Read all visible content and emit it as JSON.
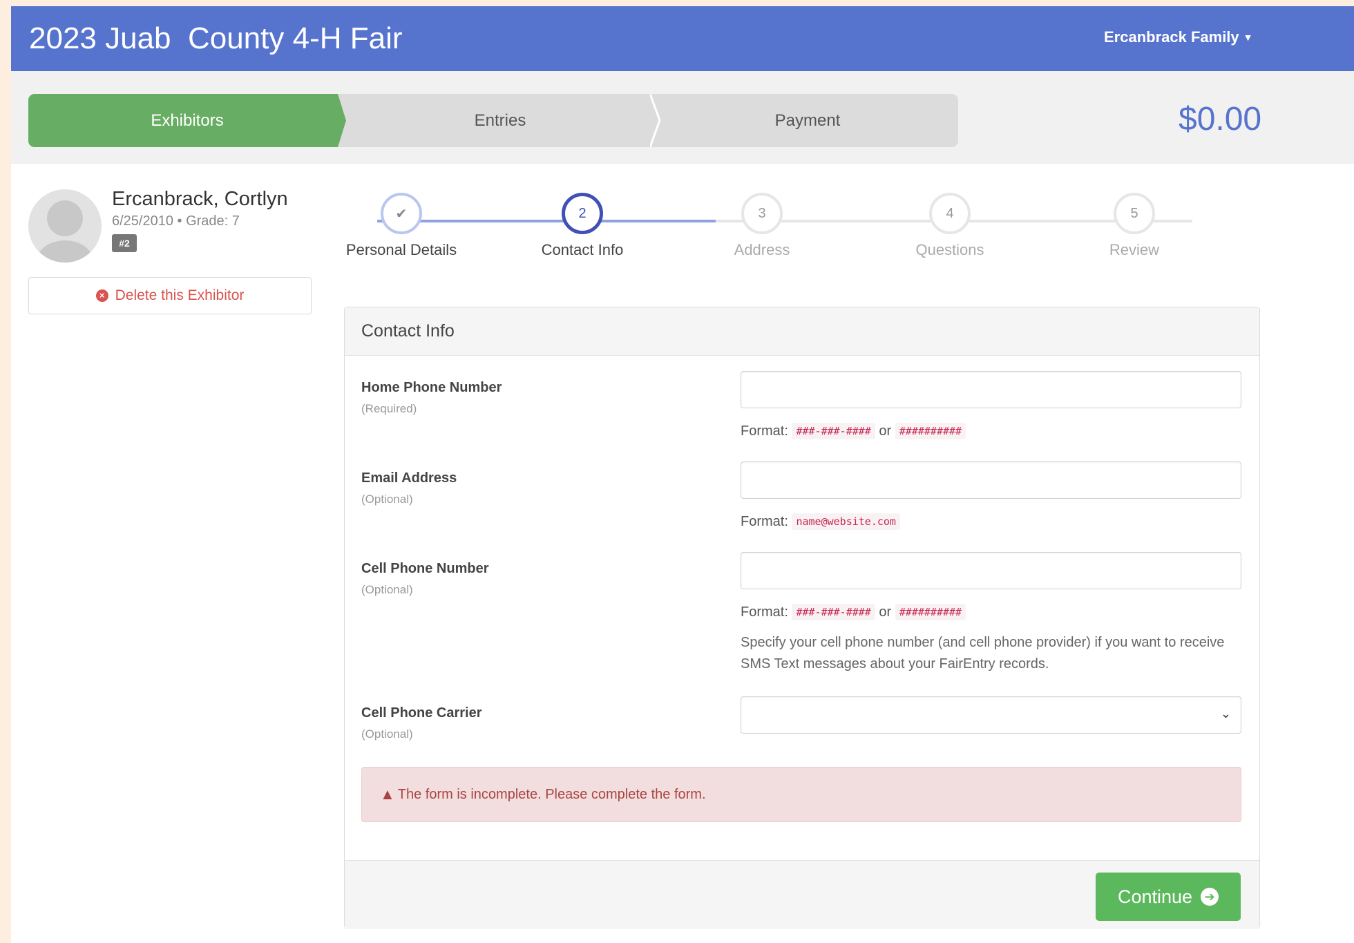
{
  "header": {
    "title": "2023 Juab  County 4-H Fair",
    "user_menu": "Ercanbrack Family"
  },
  "progress": {
    "steps": [
      "Exhibitors",
      "Entries",
      "Payment"
    ],
    "active": "Exhibitors",
    "total": "$0.00"
  },
  "exhibitor": {
    "name": "Ercanbrack, Cortlyn",
    "meta": "6/25/2010 • Grade: 7",
    "badge": "#2",
    "delete_label": "Delete this Exhibitor"
  },
  "wizard": {
    "steps": [
      {
        "number": "",
        "label": "Personal Details",
        "state": "done"
      },
      {
        "number": "2",
        "label": "Contact Info",
        "state": "active"
      },
      {
        "number": "3",
        "label": "Address",
        "state": "pending"
      },
      {
        "number": "4",
        "label": "Questions",
        "state": "pending"
      },
      {
        "number": "5",
        "label": "Review",
        "state": "pending"
      }
    ]
  },
  "form": {
    "heading": "Contact Info",
    "home_phone": {
      "label": "Home Phone Number",
      "sub": "(Required)",
      "value": "",
      "format_prefix": "Format:",
      "format_a": "###-###-####",
      "format_or": "or",
      "format_b": "##########"
    },
    "email": {
      "label": "Email Address",
      "sub": "(Optional)",
      "value": "",
      "format_prefix": "Format:",
      "format_a": "name@website.com"
    },
    "cell_phone": {
      "label": "Cell Phone Number",
      "sub": "(Optional)",
      "value": "",
      "format_prefix": "Format:",
      "format_a": "###-###-####",
      "format_or": "or",
      "format_b": "##########",
      "help": "Specify your cell phone number (and cell phone provider) if you want to receive SMS Text messages about your FairEntry records."
    },
    "carrier": {
      "label": "Cell Phone Carrier",
      "sub": "(Optional)",
      "selected": ""
    },
    "alert": "The form is incomplete. Please complete the form.",
    "continue_label": "Continue"
  },
  "colors": {
    "header": "#5673ce",
    "active_step": "#68ad64",
    "danger": "#d9534f",
    "success": "#5cb85c",
    "wizard_active": "#3f51b5"
  },
  "icons": {
    "done_step": "check-icon",
    "delete": "times-circle-icon",
    "alert": "warning-icon",
    "continue": "arrow-circle-right-icon",
    "user_menu": "caret-down-icon",
    "carrier_select": "chevron-down-icon"
  }
}
